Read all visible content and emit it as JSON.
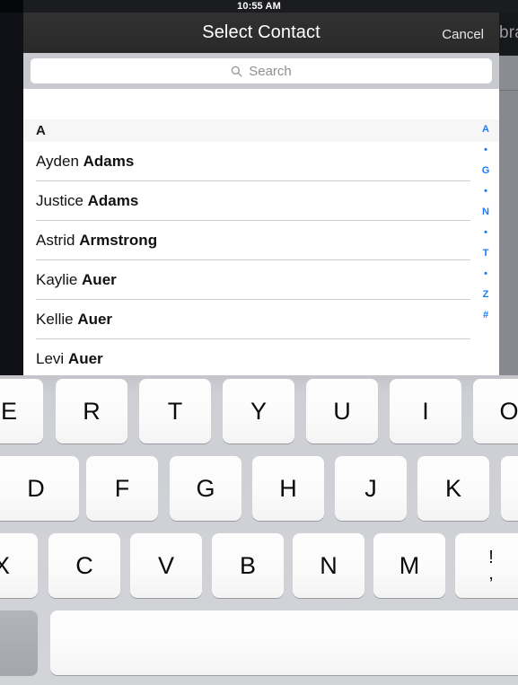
{
  "status_bar": {
    "time": "10:55 AM"
  },
  "background": {
    "partial_text": "bra"
  },
  "modal": {
    "navbar": {
      "title": "Select Contact",
      "cancel_label": "Cancel"
    },
    "search": {
      "placeholder": "Search",
      "value": "",
      "icon": "search-icon"
    },
    "list": {
      "section_header": "A",
      "rows": [
        {
          "first": "Ayden ",
          "last": "Adams"
        },
        {
          "first": "Justice ",
          "last": "Adams"
        },
        {
          "first": "Astrid ",
          "last": "Armstrong"
        },
        {
          "first": "Kaylie ",
          "last": "Auer"
        },
        {
          "first": "Kellie ",
          "last": "Auer"
        },
        {
          "first": "Levi ",
          "last": "Auer"
        }
      ]
    },
    "index_strip": [
      "A",
      "•",
      "G",
      "•",
      "N",
      "•",
      "T",
      "•",
      "Z",
      "#"
    ]
  },
  "keyboard": {
    "row1": [
      "E",
      "R",
      "T",
      "Y",
      "U",
      "I",
      "O"
    ],
    "row2": [
      "D",
      "F",
      "G",
      "H",
      "J",
      "K",
      ""
    ],
    "row3": [
      "X",
      "C",
      "V",
      "B",
      "N",
      "M"
    ],
    "row3_punct": {
      "top": "!",
      "bottom": ","
    },
    "row4": {
      "left_key": "",
      "space_key": ""
    }
  },
  "colors": {
    "accent_blue": "#1a7cf5",
    "navbar_dark": "#2d2d2d",
    "search_bg": "#c8cacf",
    "keyboard_bg": "#cdcfd4",
    "key_white": "#fbfbfb",
    "key_gray": "#aaacb2",
    "separator": "#cfcfcf",
    "section_bg": "#f6f6f6"
  }
}
